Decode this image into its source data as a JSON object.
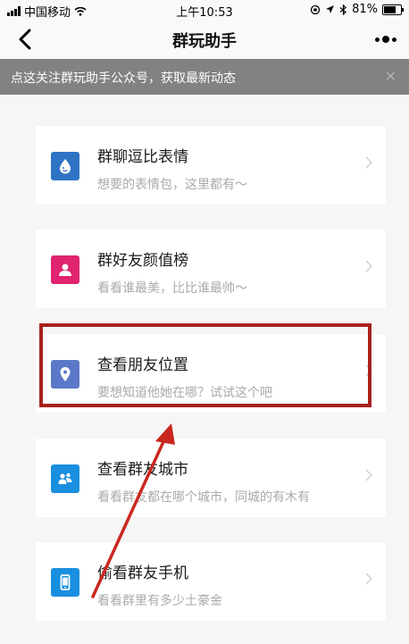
{
  "status_bar": {
    "carrier": "中国移动",
    "time": "上午10:53",
    "battery": "81%",
    "battery_level": 0.81
  },
  "nav": {
    "title": "群玩助手"
  },
  "notice": {
    "text": "点这关注群玩助手公众号，获取最新动态",
    "close": "×"
  },
  "items": [
    {
      "title": "群聊逗比表情",
      "subtitle": "想要的表情包，这里都有～",
      "icon": "emoji-drop-icon",
      "color": "#2f73c5"
    },
    {
      "title": "群好友颜值榜",
      "subtitle": "看看谁最美，比比谁最帅～",
      "icon": "person-icon",
      "color": "#e0246f"
    },
    {
      "title": "查看朋友位置",
      "subtitle": "要想知道他她在哪？试试这个吧",
      "icon": "location-pin-icon",
      "color": "#5b79c8"
    },
    {
      "title": "查看群友城市",
      "subtitle": "看看群友都在哪个城市，同城的有木有",
      "icon": "group-icon",
      "color": "#1a8fe0"
    },
    {
      "title": "偷看群友手机",
      "subtitle": "看看群里有多少土豪金",
      "icon": "phone-icon",
      "color": "#1a8fe0"
    }
  ],
  "colors": {
    "highlight": "#a8211c",
    "notice_bg": "#828282"
  }
}
